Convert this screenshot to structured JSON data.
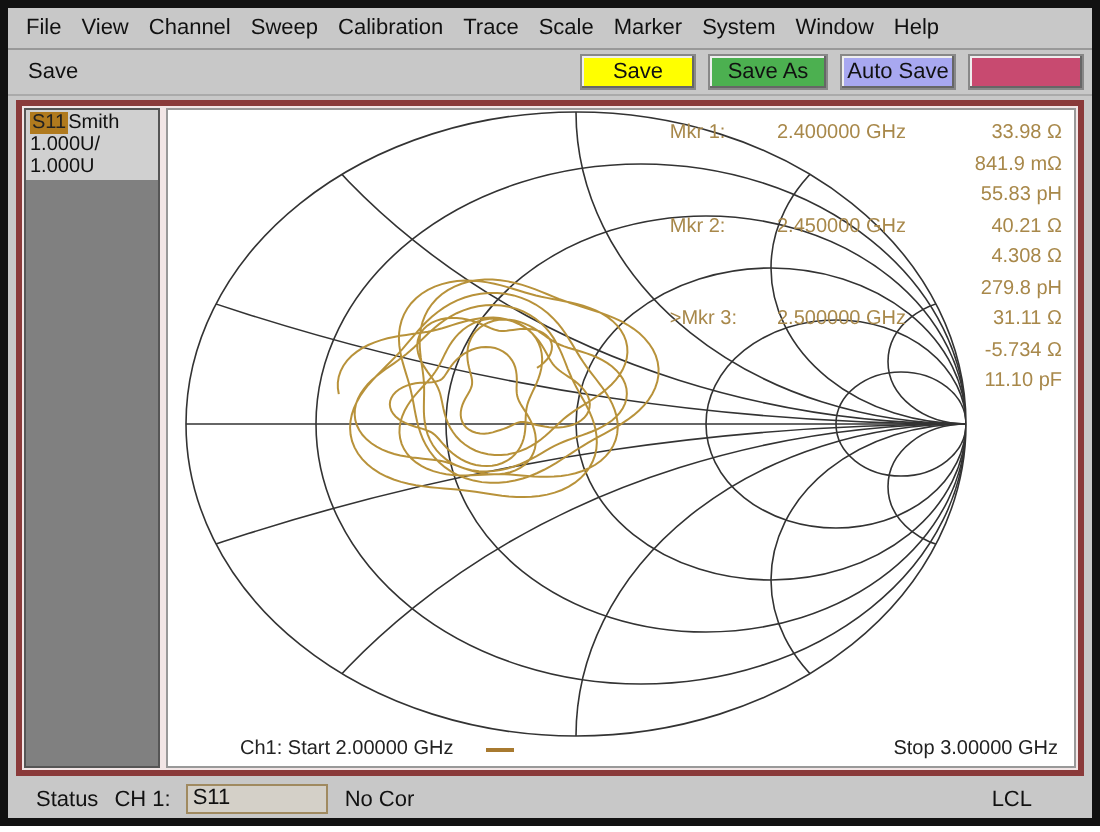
{
  "menu": [
    "File",
    "View",
    "Channel",
    "Sweep",
    "Calibration",
    "Trace",
    "Scale",
    "Marker",
    "System",
    "Window",
    "Help"
  ],
  "toolbar": {
    "title": "Save",
    "buttons": [
      {
        "label": "Save",
        "color": "#ffff00"
      },
      {
        "label": "Save As",
        "color": "#4cb050"
      },
      {
        "label": "Auto Save",
        "color": "#a8a8f0"
      },
      {
        "color": "#c84a70"
      }
    ]
  },
  "trace_panel": {
    "trace": "S11",
    "format": "Smith",
    "scale_lines": [
      "1.000U/",
      "1.000U"
    ]
  },
  "markers": [
    {
      "label": "Mkr 1:",
      "frequency": "2.400000 GHz",
      "readings": [
        "33.98 Ω",
        "841.9 mΩ",
        "55.83 pH"
      ]
    },
    {
      "label": "Mkr 2:",
      "frequency": "2.450000 GHz",
      "readings": [
        "40.21 Ω",
        "4.308 Ω",
        "279.8 pH"
      ]
    },
    {
      "label": ">Mkr 3:",
      "frequency": "2.500000 GHz",
      "readings": [
        "31.11 Ω",
        "-5.734 Ω",
        "11.10 pF"
      ]
    }
  ],
  "sweep": {
    "start": "Ch1: Start  2.00000 GHz",
    "stop": "Stop  3.00000 GHz"
  },
  "status_bar": {
    "label": "Status",
    "channel": "CH 1:",
    "parameter": "S11",
    "correction": "No Cor",
    "mode": "LCL"
  }
}
